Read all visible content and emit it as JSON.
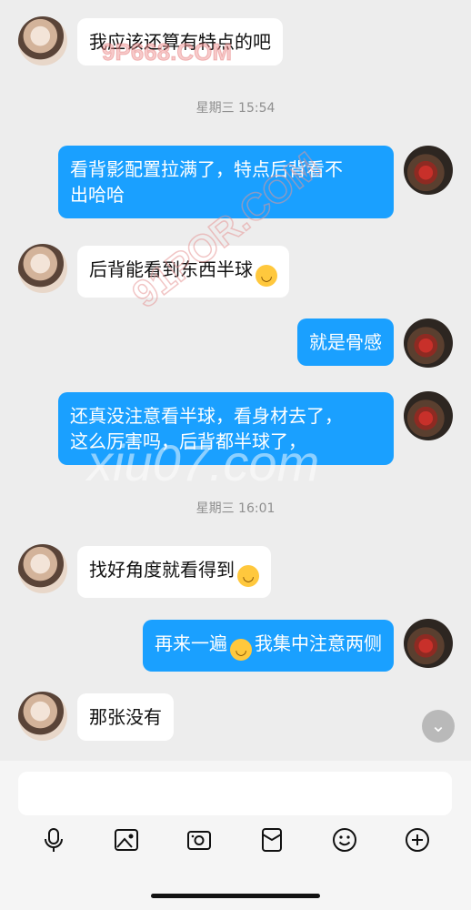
{
  "timestamps": [
    "星期三 15:54",
    "星期三 16:01"
  ],
  "messages": [
    {
      "side": "in",
      "text": "我应该还算有特点的吧"
    },
    {
      "side": "out",
      "text": "看背影配置拉满了，特点后背看不\n出哈哈"
    },
    {
      "side": "in",
      "text": "后背能看到东西半球",
      "emoji": "yawning-face"
    },
    {
      "side": "out",
      "text": "就是骨感"
    },
    {
      "side": "out",
      "text": "还真没注意看半球，看身材去了，\n这么厉害吗，后背都半球了，"
    },
    {
      "side": "in",
      "text": "找好角度就看得到",
      "emoji": "yawning-face"
    },
    {
      "side": "out",
      "text_before": "再来一遍",
      "text_after": "我集中注意两侧",
      "emoji": "yawning-face"
    },
    {
      "side": "in",
      "text": "那张没有"
    }
  ],
  "input": {
    "placeholder": ""
  },
  "toolbar": [
    "microphone-icon",
    "image-icon",
    "camera-icon",
    "red-packet-icon",
    "emoji-icon",
    "plus-icon"
  ],
  "colors": {
    "outgoing": "#1aa0ff",
    "incoming": "#ffffff",
    "background": "#ededed"
  },
  "watermarks": [
    "9P668.COM",
    "91POR.COM",
    "xiu07.com"
  ]
}
